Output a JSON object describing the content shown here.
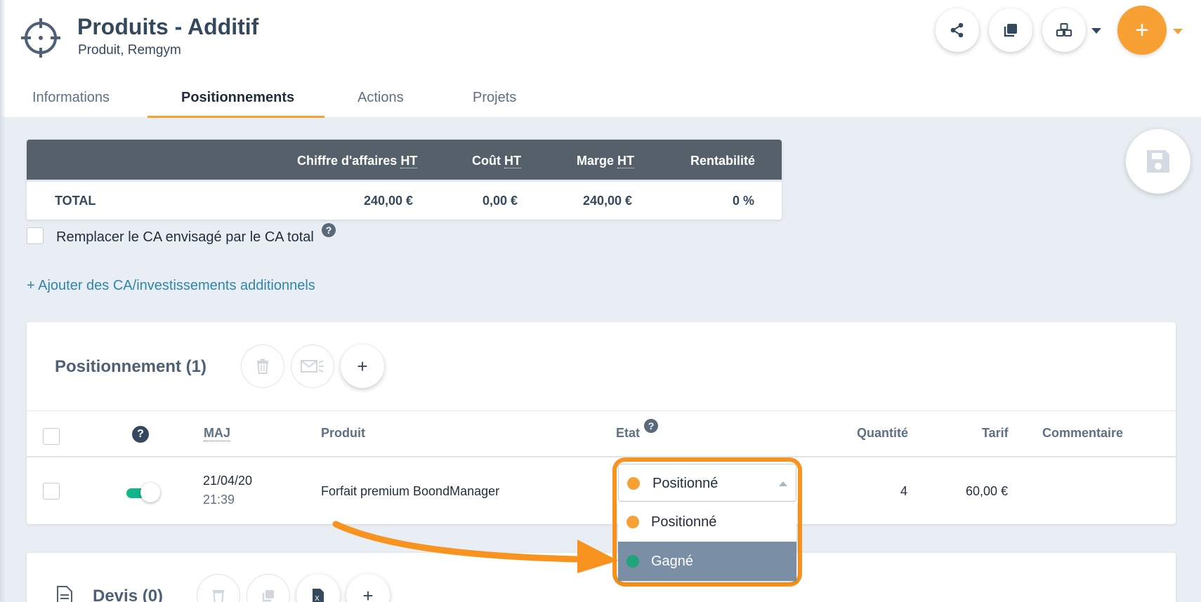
{
  "header": {
    "title": "Produits - Additif",
    "subtitle": "Produit, Remgym",
    "icon": "target-icon"
  },
  "tabs": [
    {
      "label": "Informations",
      "active": false
    },
    {
      "label": "Positionnements",
      "active": true
    },
    {
      "label": "Actions",
      "active": false
    },
    {
      "label": "Projets",
      "active": false
    }
  ],
  "actions": {
    "add_label": "+",
    "icons": [
      "share-icon",
      "copy-icon",
      "cubes-icon",
      "save-icon"
    ]
  },
  "totals": {
    "headers": {
      "ca": "Chiffre d'affaires ",
      "ca_abbr": "HT",
      "cout": "Coût ",
      "cout_abbr": "HT",
      "marge": "Marge ",
      "marge_abbr": "HT",
      "rent": "Rentabilité"
    },
    "row": {
      "label": "TOTAL",
      "ca": "240,00 €",
      "cout": "0,00 €",
      "marge": "240,00 €",
      "rent": "0 %"
    }
  },
  "options": {
    "replace_label": "Remplacer le CA envisagé par le CA total",
    "replace_checked": false,
    "help": "?",
    "add_link": "+ Ajouter des CA/investissements additionnels"
  },
  "positionnement": {
    "title": "Positionnement (1)",
    "add_label": "+",
    "columns": {
      "help": "?",
      "maj": "MAJ",
      "produit": "Produit",
      "etat": "Etat",
      "quantite": "Quantité",
      "tarif": "Tarif",
      "commentaire": "Commentaire"
    },
    "rows": [
      {
        "date": "21/04/20",
        "time": "21:39",
        "produit": "Forfait premium BoondManager",
        "etat": "Positionné",
        "quantite": "4",
        "tarif": "60,00 €",
        "commentaire": "",
        "toggle_on": true
      }
    ]
  },
  "etat_dropdown": {
    "selected": "Positionné",
    "options": [
      {
        "label": "Positionné",
        "color": "#f7a135"
      },
      {
        "label": "Gagné",
        "color": "#1fa37a"
      }
    ]
  },
  "devis": {
    "title": "Devis (0)",
    "add_label": "+"
  },
  "colors": {
    "accent": "#f7a135",
    "highlight": "#f7931e",
    "header_dark": "#55606b",
    "link": "#2e86ab",
    "toggle_on": "#15b48c"
  }
}
